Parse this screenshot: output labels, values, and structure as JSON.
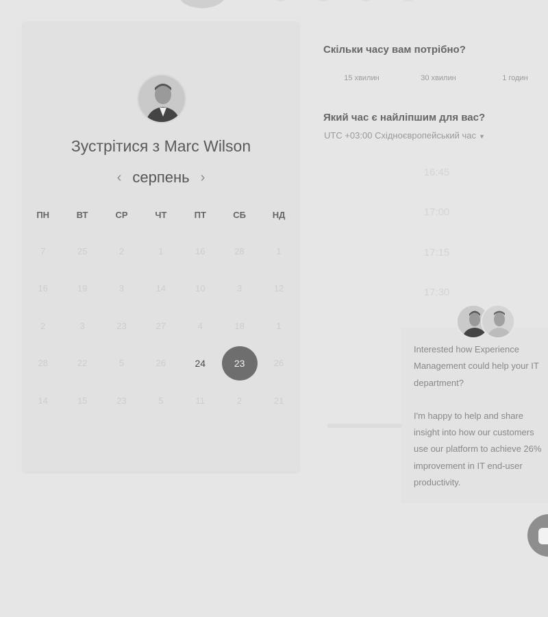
{
  "colors": {
    "background": "#e6e6e6",
    "card": "#e1e1e1",
    "selected_day": "#6e6e6e",
    "chat_button": "#8e8e8e"
  },
  "booking": {
    "title_prefix": "Зустрітися з",
    "host_name": "Marc Wilson",
    "month": "серпень",
    "prev_icon": "chevron-left-icon",
    "next_icon": "chevron-right-icon",
    "weekdays": [
      "ПН",
      "ВТ",
      "СР",
      "ЧТ",
      "ПТ",
      "СБ",
      "НД"
    ],
    "weeks": [
      [
        "7",
        "25",
        "2",
        "1",
        "16",
        "28",
        "1"
      ],
      [
        "16",
        "19",
        "3",
        "14",
        "10",
        "3",
        "12"
      ],
      [
        "2",
        "3",
        "23",
        "27",
        "4",
        "18",
        "1"
      ],
      [
        "28",
        "22",
        "5",
        "26",
        "24",
        "23",
        "26"
      ],
      [
        "14",
        "15",
        "23",
        "5",
        "11",
        "2",
        "21"
      ]
    ],
    "available_day": "24",
    "selected_day": "23"
  },
  "duration": {
    "question": "Скільки часу вам потрібно?",
    "options": [
      "15 хвилин",
      "30 хвилин",
      "1 годин"
    ]
  },
  "time": {
    "question": "Який час є найліпшим для вас?",
    "timezone": "UTC +03:00 Східноєвропейський час",
    "slots": [
      "16:45",
      "17:00",
      "17:15",
      "17:30"
    ]
  },
  "chat": {
    "message_1": "Interested how Experience Management could help your IT department?",
    "message_2": "I'm happy to help and share insight into how our customers use our platform to achieve 26% improvement in IT end-user productivity.",
    "button_icon": "chat-bubble-icon"
  }
}
